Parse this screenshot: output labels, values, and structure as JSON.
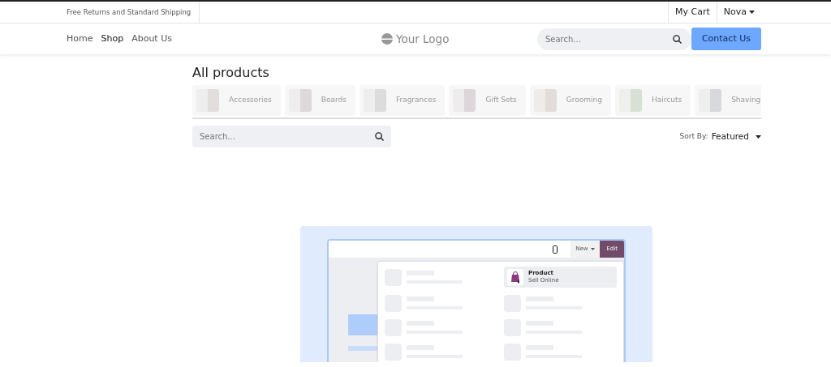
{
  "topbar": {
    "announcement": "Free Returns and Standard Shipping",
    "cart": "My Cart",
    "user": "Nova"
  },
  "navbar": {
    "links": [
      {
        "label": "Home",
        "selected": false
      },
      {
        "label": "Shop",
        "selected": true
      },
      {
        "label": "About Us"
      }
    ],
    "logo": "Your Logo",
    "search": {
      "placeholder": "Search..."
    },
    "cta": "Contact Us"
  },
  "page": {
    "title": "All products",
    "categories": [
      {
        "label": "Accessories"
      },
      {
        "label": "Beards"
      },
      {
        "label": "Fragrances"
      },
      {
        "label": "Gift Sets"
      },
      {
        "label": "Grooming"
      },
      {
        "label": "Haircuts"
      },
      {
        "label": "Shaving"
      }
    ],
    "search": {
      "placeholder": "Search..."
    },
    "sort": {
      "label": "Sort By:",
      "value": "Featured"
    }
  },
  "illustration": {
    "new_button": "New",
    "edit_button": "Edit",
    "product": {
      "title": "Product",
      "subtitle": "Sell Online"
    }
  }
}
